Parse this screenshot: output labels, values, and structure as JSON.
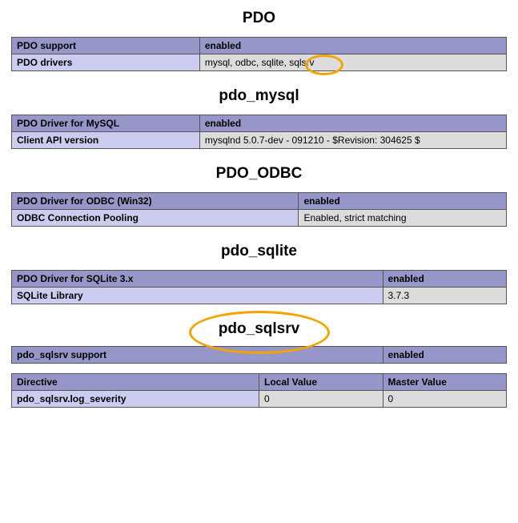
{
  "sections": {
    "pdo": {
      "title": "PDO",
      "header_left": "PDO support",
      "header_right": "enabled",
      "row_label": "PDO drivers",
      "row_value": "mysql, odbc, sqlite, sqlsrv"
    },
    "pdo_mysql": {
      "title": "pdo_mysql",
      "header_left": "PDO Driver for MySQL",
      "header_right": "enabled",
      "row_label": "Client API version",
      "row_value": "mysqlnd 5.0.7-dev - 091210 - $Revision: 304625 $"
    },
    "pdo_odbc": {
      "title": "PDO_ODBC",
      "header_left": "PDO Driver for ODBC (Win32)",
      "header_right": "enabled",
      "row_label": "ODBC Connection Pooling",
      "row_value": "Enabled, strict matching"
    },
    "pdo_sqlite": {
      "title": "pdo_sqlite",
      "header_left": "PDO Driver for SQLite 3.x",
      "header_right": "enabled",
      "row_label": "SQLite Library",
      "row_value": "3.7.3"
    },
    "pdo_sqlsrv": {
      "title": "pdo_sqlsrv",
      "support_header_left": "pdo_sqlsrv support",
      "support_header_right": "enabled",
      "dir_header_directive": "Directive",
      "dir_header_local": "Local Value",
      "dir_header_master": "Master Value",
      "dir_row_name": "pdo_sqlsrv.log_severity",
      "dir_row_local": "0",
      "dir_row_master": "0"
    }
  }
}
